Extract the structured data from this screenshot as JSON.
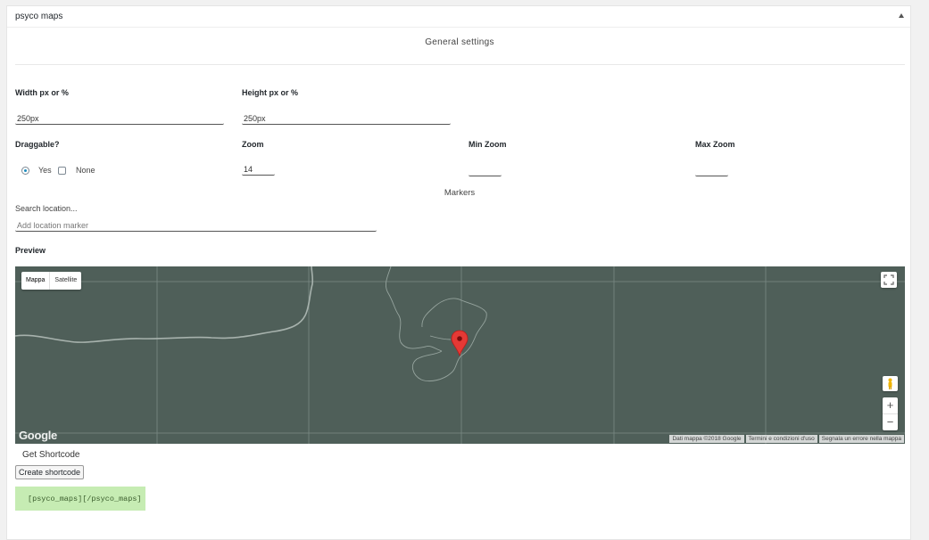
{
  "panel": {
    "title": "psyco maps",
    "toggle_icon": "triangle-up-icon"
  },
  "general": {
    "heading": "General settings"
  },
  "width": {
    "label": "Width px or %",
    "value": "250px"
  },
  "height": {
    "label": "Height px or %",
    "value": "250px"
  },
  "draggable": {
    "label": "Draggable?",
    "yes_label": "Yes",
    "none_label": "None",
    "selected": "Yes"
  },
  "zoom": {
    "label": "Zoom",
    "value": "14"
  },
  "min_zoom": {
    "label": "Min Zoom",
    "value": ""
  },
  "max_zoom": {
    "label": "Max Zoom",
    "value": ""
  },
  "markers": {
    "heading": "Markers"
  },
  "search": {
    "label": "Search location...",
    "placeholder": "Add location marker"
  },
  "preview": {
    "label": "Preview"
  },
  "map": {
    "type_map": "Mappa",
    "type_satellite": "Satellite",
    "logo": "Google",
    "attribution_data": "Dati mappa ©2018 Google",
    "attribution_terms": "Termini e condizioni d'uso",
    "attribution_report": "Segnala un errore nella mappa",
    "zoom_in": "+",
    "zoom_out": "−",
    "bg_color": "#4f5f59",
    "marker_color": "#e53935"
  },
  "shortcode": {
    "heading": "Get Shortcode",
    "button_label": "Create shortcode",
    "output": "[psyco_maps][/psyco_maps]",
    "box_color": "#c6ecb3"
  }
}
